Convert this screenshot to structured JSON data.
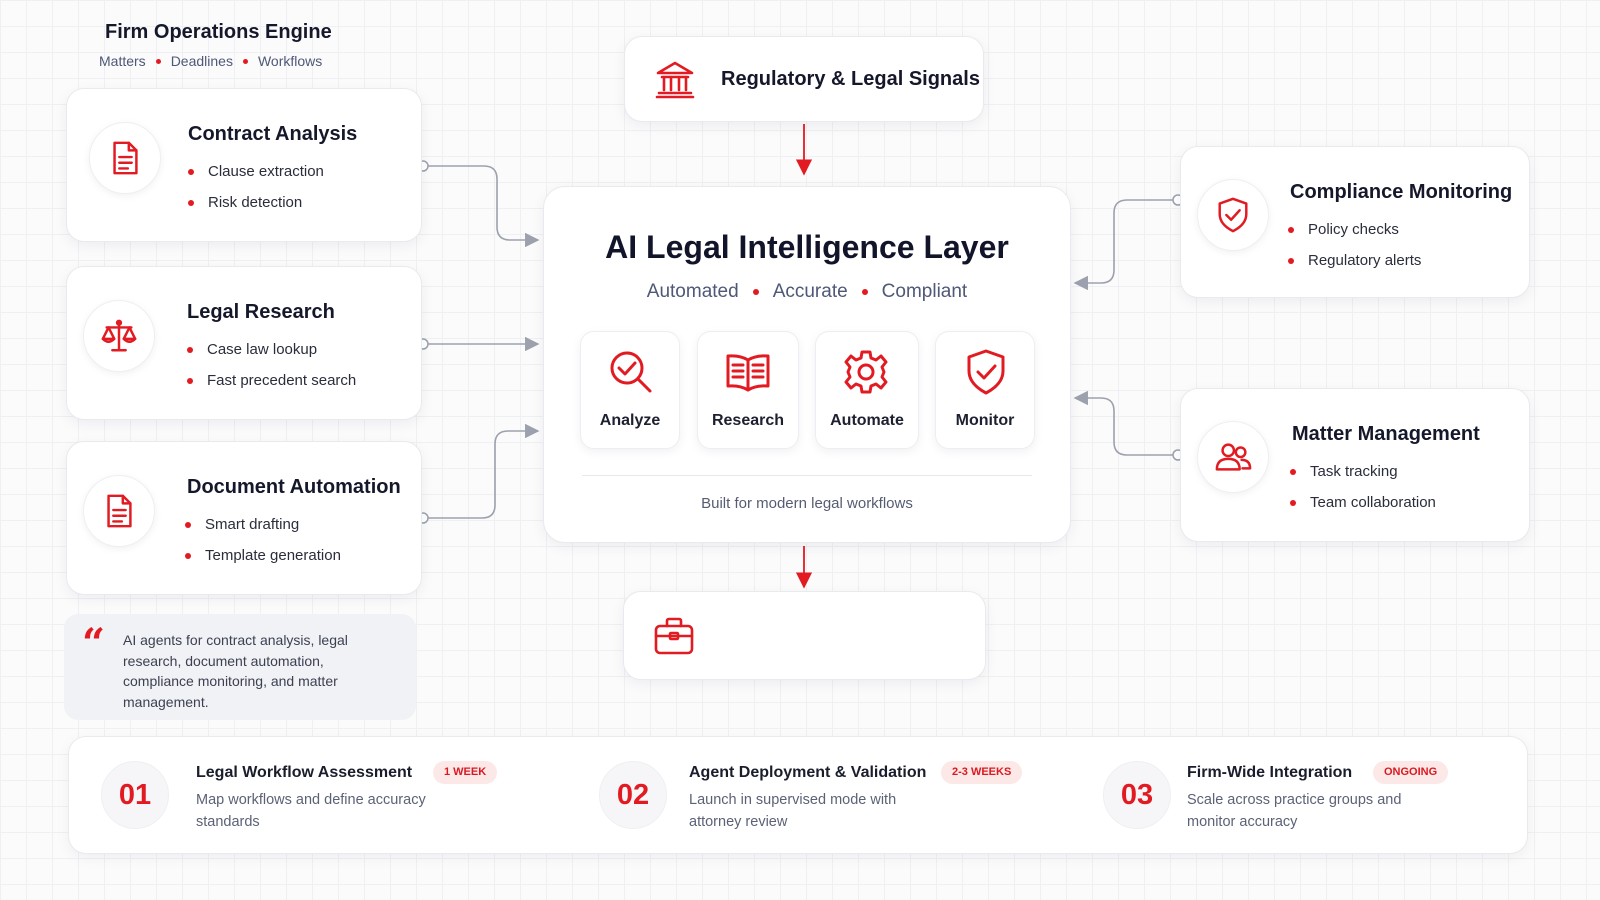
{
  "signals": {
    "title": "Regulatory & Legal Signals",
    "icon": "bank-icon"
  },
  "left_cards": [
    {
      "title": "Contract Analysis",
      "icon": "document-icon",
      "bullets": [
        "Clause extraction",
        "Risk detection"
      ]
    },
    {
      "title": "Legal Research",
      "icon": "scales-icon",
      "bullets": [
        "Case law lookup",
        "Fast precedent search"
      ]
    },
    {
      "title": "Document Automation",
      "icon": "document-icon",
      "bullets": [
        "Smart drafting",
        "Template generation"
      ]
    }
  ],
  "right_cards": [
    {
      "title": "Compliance Monitoring",
      "icon": "shield-check-icon",
      "bullets": [
        "Policy checks",
        "Regulatory alerts"
      ]
    },
    {
      "title": "Matter Management",
      "icon": "users-icon",
      "bullets": [
        "Task tracking",
        "Team collaboration"
      ]
    }
  ],
  "center": {
    "title": "AI Legal Intelligence Layer",
    "tags": [
      "Automated",
      "Accurate",
      "Compliant"
    ],
    "capabilities": [
      {
        "label": "Analyze",
        "icon": "magnify-check-icon"
      },
      {
        "label": "Research",
        "icon": "book-icon"
      },
      {
        "label": "Automate",
        "icon": "gear-icon"
      },
      {
        "label": "Monitor",
        "icon": "shield-check-icon"
      }
    ],
    "footer": "Built for modern legal workflows"
  },
  "engine": {
    "title": "Firm Operations Engine",
    "icon": "briefcase-icon",
    "tags": [
      "Matters",
      "Deadlines",
      "Workflows"
    ]
  },
  "quote": {
    "mark": "“",
    "text": "AI agents for contract analysis, legal research, document automation, compliance monitoring, and matter management."
  },
  "timeline": [
    {
      "number": "01",
      "title": "Legal Workflow Assessment",
      "badge": "1 WEEK",
      "description": "Map workflows and define accuracy standards"
    },
    {
      "number": "02",
      "title": "Agent Deployment & Validation",
      "badge": "2-3 WEEKS",
      "description": "Launch in supervised mode with attorney review"
    },
    {
      "number": "03",
      "title": "Firm-Wide Integration",
      "badge": "ONGOING",
      "description": "Scale across practice groups and monitor accuracy"
    }
  ],
  "colors": {
    "accent": "#e21b22",
    "connector": "#9ca1ad",
    "text": "#15182a",
    "muted": "#4e5877"
  }
}
